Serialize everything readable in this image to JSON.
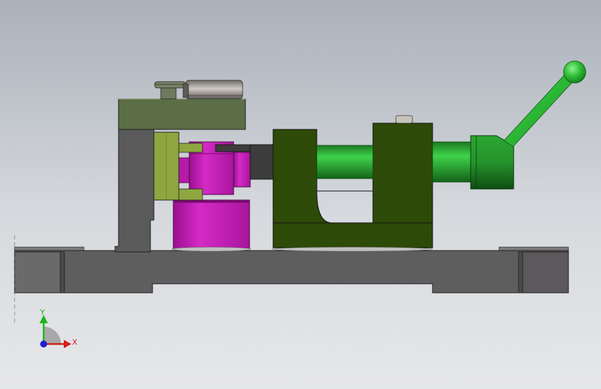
{
  "viewport": {
    "background_top": "#aab1ba",
    "background_bottom": "#e6e7e9"
  },
  "model": {
    "colors": {
      "base_plate": "#5e5e5e",
      "base_end_blocks": "#6a6a6a",
      "column": "#5a5a5a",
      "top_arm": "#5b6e46",
      "yellow_green_jaw": "#8fa640",
      "magenta_part": "#c51ab8",
      "dark_green_body": "#2e4a08",
      "light_green_handle": "#2dbb3a",
      "dark_insert": "#3c3c3c"
    },
    "parts": [
      "base-plate",
      "vertical-column",
      "top-arm",
      "clamp-screw",
      "knurled-nut",
      "locating-jaw",
      "workpiece-upper",
      "workpiece-lower",
      "vise-body",
      "slide-rod",
      "handle-hub",
      "handle-lever",
      "handle-ball"
    ]
  },
  "triad": {
    "x_label": "X",
    "y_label": "Y",
    "x_color": "#d41e1e",
    "y_color": "#1eb41e",
    "z_color": "#1e1ed4"
  }
}
